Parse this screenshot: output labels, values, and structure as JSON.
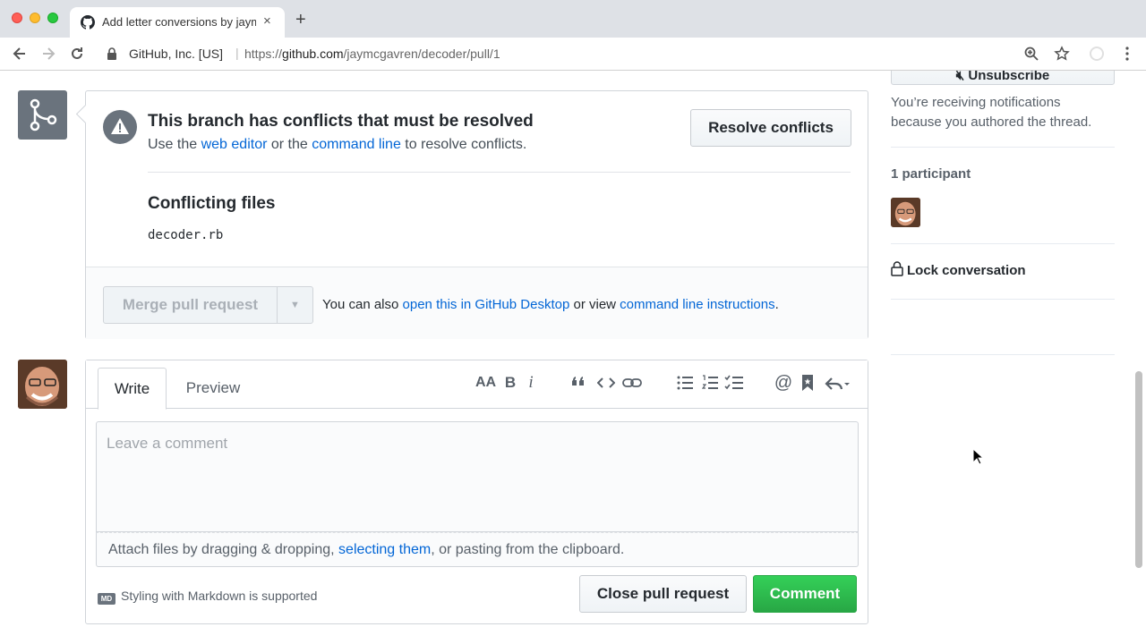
{
  "browser": {
    "tab_title": "Add letter conversions by jaym",
    "tab_close": "×",
    "new_tab": "+",
    "site_identity": "GitHub, Inc. [US]",
    "url_prefix": "https://",
    "url_host": "github.com",
    "url_path": "/jaymcgavren/decoder/pull/1"
  },
  "merge_status": {
    "title": "This branch has conflicts that must be resolved",
    "desc_pre": "Use the ",
    "web_editor_link": "web editor",
    "desc_mid": " or the ",
    "command_line_link": "command line",
    "desc_post": " to resolve conflicts.",
    "resolve_button": "Resolve conflicts",
    "conflicting_files_title": "Conflicting files",
    "conflicting_files": [
      "decoder.rb"
    ],
    "merge_button": "Merge pull request",
    "alt_pre": "You can also ",
    "desktop_link": "open this in GitHub Desktop",
    "alt_mid": " or view ",
    "instructions_link": "command line instructions",
    "alt_post": "."
  },
  "comment_form": {
    "tabs": [
      "Write",
      "Preview"
    ],
    "active_tab": "Write",
    "placeholder": "Leave a comment",
    "attach_pre": "Attach files by dragging & dropping, ",
    "attach_link": "selecting them",
    "attach_post": ", or pasting from the clipboard.",
    "markdown_badge": "MD",
    "markdown_note": "Styling with Markdown is supported",
    "close_button": "Close pull request",
    "comment_button": "Comment",
    "toolbar": {
      "header": "AA",
      "bold": "B",
      "italic": "i"
    }
  },
  "sidebar": {
    "unsubscribe": "Unsubscribe",
    "notification_reason": "You’re receiving notifications because you authored the thread.",
    "participants_heading": "1 participant",
    "lock_conversation": "Lock conversation"
  },
  "colors": {
    "link": "#0366d6",
    "comment_button": "#2cbe4e",
    "alert_icon": "#6a737d"
  }
}
